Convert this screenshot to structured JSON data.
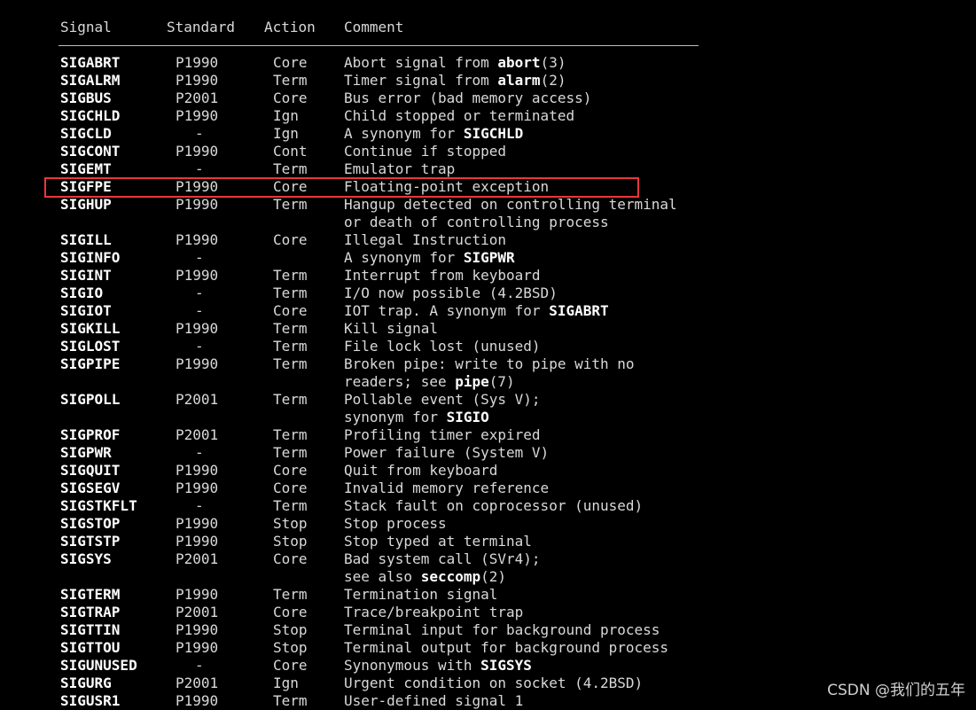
{
  "headers": {
    "signal": "Signal",
    "standard": "Standard",
    "action": "Action",
    "comment": "Comment"
  },
  "highlight_color": "#e8373e",
  "highlighted_signal": "SIGFPE",
  "watermark": "CSDN @我们的五年",
  "rows": [
    {
      "signal": "SIGABRT",
      "standard": "P1990",
      "action": "Core",
      "comment": [
        {
          "t": "Abort signal from "
        },
        {
          "t": "abort",
          "b": true
        },
        {
          "t": "(3)"
        }
      ]
    },
    {
      "signal": "SIGALRM",
      "standard": "P1990",
      "action": "Term",
      "comment": [
        {
          "t": "Timer signal from "
        },
        {
          "t": "alarm",
          "b": true
        },
        {
          "t": "(2)"
        }
      ]
    },
    {
      "signal": "SIGBUS",
      "standard": "P2001",
      "action": "Core",
      "comment": [
        {
          "t": "Bus error (bad memory access)"
        }
      ]
    },
    {
      "signal": "SIGCHLD",
      "standard": "P1990",
      "action": "Ign",
      "comment": [
        {
          "t": "Child stopped or terminated"
        }
      ]
    },
    {
      "signal": "SIGCLD",
      "standard": "-",
      "action": "Ign",
      "comment": [
        {
          "t": "A synonym for "
        },
        {
          "t": "SIGCHLD",
          "b": true
        }
      ]
    },
    {
      "signal": "SIGCONT",
      "standard": "P1990",
      "action": "Cont",
      "comment": [
        {
          "t": "Continue if stopped"
        }
      ]
    },
    {
      "signal": "SIGEMT",
      "standard": "-",
      "action": "Term",
      "comment": [
        {
          "t": "Emulator trap"
        }
      ]
    },
    {
      "signal": "SIGFPE",
      "standard": "P1990",
      "action": "Core",
      "comment": [
        {
          "t": "Floating-point exception"
        }
      ]
    },
    {
      "signal": "SIGHUP",
      "standard": "P1990",
      "action": "Term",
      "comment": [
        {
          "t": "Hangup detected on controlling terminal"
        }
      ]
    },
    {
      "signal": "",
      "standard": "",
      "action": "",
      "comment": [
        {
          "t": "or death of controlling process"
        }
      ]
    },
    {
      "signal": "SIGILL",
      "standard": "P1990",
      "action": "Core",
      "comment": [
        {
          "t": "Illegal Instruction"
        }
      ]
    },
    {
      "signal": "SIGINFO",
      "standard": "-",
      "action": "",
      "comment": [
        {
          "t": "A synonym for "
        },
        {
          "t": "SIGPWR",
          "b": true
        }
      ]
    },
    {
      "signal": "SIGINT",
      "standard": "P1990",
      "action": "Term",
      "comment": [
        {
          "t": "Interrupt from keyboard"
        }
      ]
    },
    {
      "signal": "SIGIO",
      "standard": "-",
      "action": "Term",
      "comment": [
        {
          "t": "I/O now possible (4.2BSD)"
        }
      ]
    },
    {
      "signal": "SIGIOT",
      "standard": "-",
      "action": "Core",
      "comment": [
        {
          "t": "IOT trap. A synonym for "
        },
        {
          "t": "SIGABRT",
          "b": true
        }
      ]
    },
    {
      "signal": "SIGKILL",
      "standard": "P1990",
      "action": "Term",
      "comment": [
        {
          "t": "Kill signal"
        }
      ]
    },
    {
      "signal": "SIGLOST",
      "standard": "-",
      "action": "Term",
      "comment": [
        {
          "t": "File lock lost (unused)"
        }
      ]
    },
    {
      "signal": "SIGPIPE",
      "standard": "P1990",
      "action": "Term",
      "comment": [
        {
          "t": "Broken pipe: write to pipe with no"
        }
      ]
    },
    {
      "signal": "",
      "standard": "",
      "action": "",
      "comment": [
        {
          "t": "readers; see "
        },
        {
          "t": "pipe",
          "b": true
        },
        {
          "t": "(7)"
        }
      ]
    },
    {
      "signal": "SIGPOLL",
      "standard": "P2001",
      "action": "Term",
      "comment": [
        {
          "t": "Pollable event (Sys V);"
        }
      ]
    },
    {
      "signal": "",
      "standard": "",
      "action": "",
      "comment": [
        {
          "t": "synonym for "
        },
        {
          "t": "SIGIO",
          "b": true
        }
      ]
    },
    {
      "signal": "SIGPROF",
      "standard": "P2001",
      "action": "Term",
      "comment": [
        {
          "t": "Profiling timer expired"
        }
      ]
    },
    {
      "signal": "SIGPWR",
      "standard": "-",
      "action": "Term",
      "comment": [
        {
          "t": "Power failure (System V)"
        }
      ]
    },
    {
      "signal": "SIGQUIT",
      "standard": "P1990",
      "action": "Core",
      "comment": [
        {
          "t": "Quit from keyboard"
        }
      ]
    },
    {
      "signal": "SIGSEGV",
      "standard": "P1990",
      "action": "Core",
      "comment": [
        {
          "t": "Invalid memory reference"
        }
      ]
    },
    {
      "signal": "SIGSTKFLT",
      "standard": "-",
      "action": "Term",
      "comment": [
        {
          "t": "Stack fault on coprocessor (unused)"
        }
      ]
    },
    {
      "signal": "SIGSTOP",
      "standard": "P1990",
      "action": "Stop",
      "comment": [
        {
          "t": "Stop process"
        }
      ]
    },
    {
      "signal": "SIGTSTP",
      "standard": "P1990",
      "action": "Stop",
      "comment": [
        {
          "t": "Stop typed at terminal"
        }
      ]
    },
    {
      "signal": "SIGSYS",
      "standard": "P2001",
      "action": "Core",
      "comment": [
        {
          "t": "Bad system call (SVr4);"
        }
      ]
    },
    {
      "signal": "",
      "standard": "",
      "action": "",
      "comment": [
        {
          "t": "see also "
        },
        {
          "t": "seccomp",
          "b": true
        },
        {
          "t": "(2)"
        }
      ]
    },
    {
      "signal": "SIGTERM",
      "standard": "P1990",
      "action": "Term",
      "comment": [
        {
          "t": "Termination signal"
        }
      ]
    },
    {
      "signal": "SIGTRAP",
      "standard": "P2001",
      "action": "Core",
      "comment": [
        {
          "t": "Trace/breakpoint trap"
        }
      ]
    },
    {
      "signal": "SIGTTIN",
      "standard": "P1990",
      "action": "Stop",
      "comment": [
        {
          "t": "Terminal input for background process"
        }
      ]
    },
    {
      "signal": "SIGTTOU",
      "standard": "P1990",
      "action": "Stop",
      "comment": [
        {
          "t": "Terminal output for background process"
        }
      ]
    },
    {
      "signal": "SIGUNUSED",
      "standard": "-",
      "action": "Core",
      "comment": [
        {
          "t": "Synonymous with "
        },
        {
          "t": "SIGSYS",
          "b": true
        }
      ]
    },
    {
      "signal": "SIGURG",
      "standard": "P2001",
      "action": "Ign",
      "comment": [
        {
          "t": "Urgent condition on socket (4.2BSD)"
        }
      ]
    },
    {
      "signal": "SIGUSR1",
      "standard": "P1990",
      "action": "Term",
      "comment": [
        {
          "t": "User-defined signal 1"
        }
      ]
    }
  ]
}
